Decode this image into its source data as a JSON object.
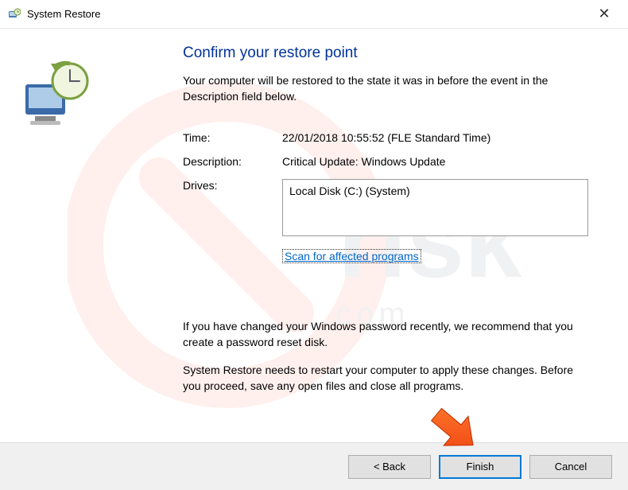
{
  "titlebar": {
    "title": "System Restore"
  },
  "heading": "Confirm your restore point",
  "subtext": "Your computer will be restored to the state it was in before the event in the Description field below.",
  "rows": {
    "time_label": "Time:",
    "time_value": "22/01/2018 10:55:52 (FLE Standard Time)",
    "desc_label": "Description:",
    "desc_value": "Critical Update: Windows Update",
    "drives_label": "Drives:",
    "drives_value": "Local Disk (C:) (System)"
  },
  "scan_link": "Scan for affected programs",
  "warning1": "If you have changed your Windows password recently, we recommend that you create a password reset disk.",
  "warning2": "System Restore needs to restart your computer to apply these changes. Before you proceed, save any open files and close all programs.",
  "buttons": {
    "back": "< Back",
    "finish": "Finish",
    "cancel": "Cancel"
  }
}
